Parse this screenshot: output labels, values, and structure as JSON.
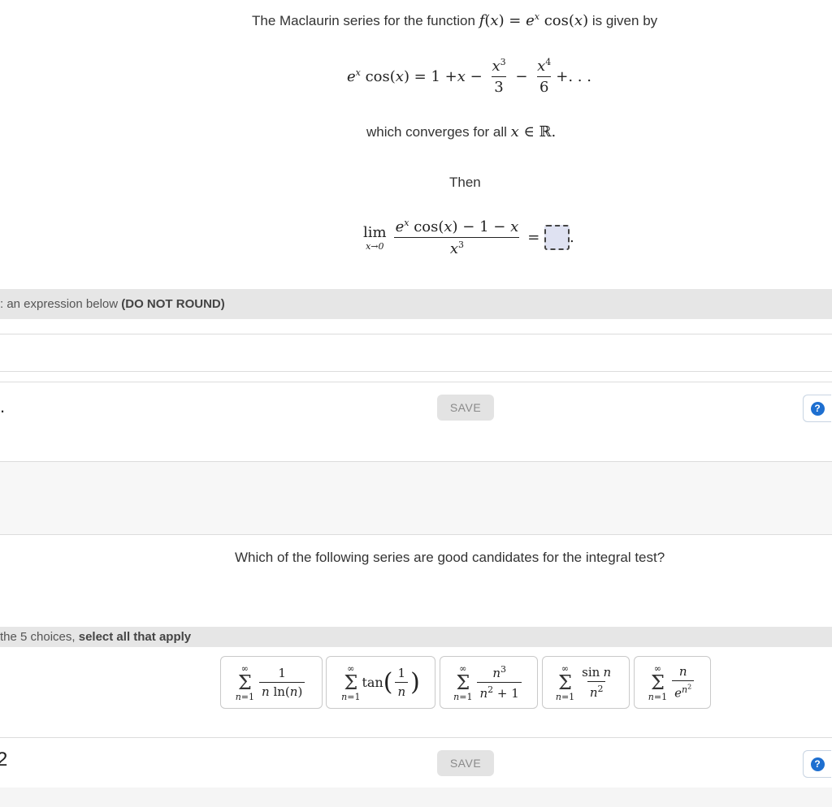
{
  "q1": {
    "intro_text": "The Maclaurin series for the function",
    "intro_suffix": "is given by",
    "converges_text": "which converges for all",
    "then_text": "Then",
    "section_bar_label": ": an expression below",
    "section_bar_bold": "(DO NOT ROUND)",
    "answer_input_value": "",
    "save_label": "SAVE",
    "left_marker": ".",
    "help_label": "?"
  },
  "q2": {
    "question_text": "Which of the following series are good candidates for the integral test?",
    "section_bar_label": "the 5 choices,",
    "section_bar_bold": "select all that apply",
    "save_label": "SAVE",
    "left_marker": "2",
    "help_label": "?",
    "choices": [
      {
        "id": "choice-1",
        "selected": false
      },
      {
        "id": "choice-2",
        "selected": false
      },
      {
        "id": "choice-3",
        "selected": false
      },
      {
        "id": "choice-4",
        "selected": false
      },
      {
        "id": "choice-5",
        "selected": false
      }
    ]
  },
  "colors": {
    "bar_bg": "#e6e6e6",
    "help_blue": "#1e6fd0",
    "save_bg": "#e3e3e3",
    "answer_box": "#dfe2f2"
  }
}
